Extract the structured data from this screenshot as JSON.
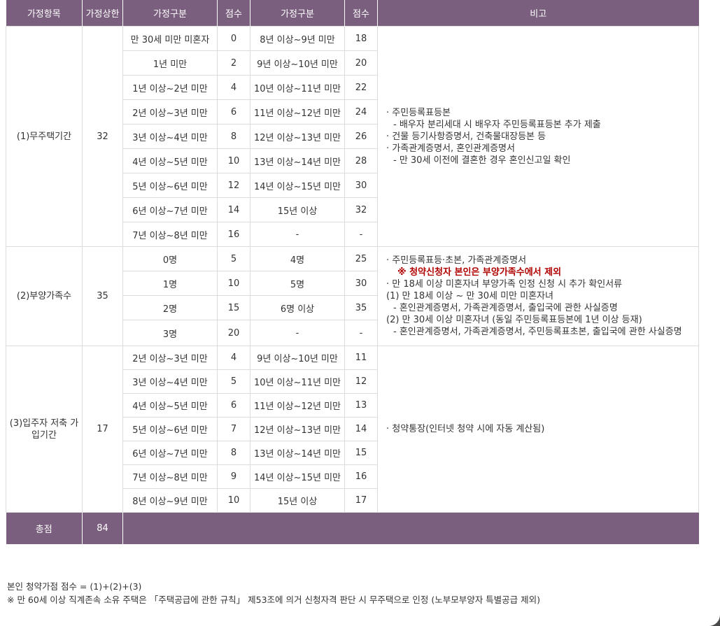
{
  "headers": [
    "가정항목",
    "가정상한",
    "가정구분",
    "점수",
    "가정구분",
    "점수",
    "비고"
  ],
  "sections": [
    {
      "item": "(1)무주택기간",
      "cap": "32",
      "rows": [
        [
          "만 30세 미만 미혼자",
          "0",
          "8년 이상~9년 미만",
          "18"
        ],
        [
          "1년 미만",
          "2",
          "9년 이상~10년 미만",
          "20"
        ],
        [
          "1년 이상~2년 미만",
          "4",
          "10년 이상~11년 미만",
          "22"
        ],
        [
          "2년 이상~3년 미만",
          "6",
          "11년 이상~12년 미만",
          "24"
        ],
        [
          "3년 이상~4년 미만",
          "8",
          "12년 이상~13년 미만",
          "26"
        ],
        [
          "4년 이상~5년 미만",
          "10",
          "13년 이상~14년 미만",
          "28"
        ],
        [
          "5년 이상~6년 미만",
          "12",
          "14년 이상~15년 미만",
          "30"
        ],
        [
          "6년 이상~7년 미만",
          "14",
          "15년 이상",
          "32"
        ],
        [
          "7년 이상~8년 미만",
          "16",
          "-",
          "-"
        ]
      ],
      "notes": [
        {
          "style": "main",
          "text": "· 주민등록표등본"
        },
        {
          "style": "sub",
          "text": "- 배우자 분리세대 시 배우자 주민등록표등본 추가 제출"
        },
        {
          "style": "main",
          "text": "· 건물 등기사항증명서, 건축물대장등본 등"
        },
        {
          "style": "main",
          "text": "· 가족관계증명서, 혼인관계증명서"
        },
        {
          "style": "sub",
          "text": "- 만 30세 이전에 결혼한 경우 혼인신고일 확인"
        }
      ]
    },
    {
      "item": "(2)부양가족수",
      "cap": "35",
      "rows": [
        [
          "0명",
          "5",
          "4명",
          "25"
        ],
        [
          "1명",
          "10",
          "5명",
          "30"
        ],
        [
          "2명",
          "15",
          "6명 이상",
          "35"
        ],
        [
          "3명",
          "20",
          "-",
          "-"
        ]
      ],
      "notes": [
        {
          "style": "main",
          "text": "· 주민등록표등·초본, 가족관계증명서"
        },
        {
          "style": "warn",
          "text": "※ 청약신청자 본인은 부양가족수에서 제외"
        },
        {
          "style": "main",
          "text": "· 만 18세 이상 미혼자녀 부양가족 인정 신청 시 추가 확인서류"
        },
        {
          "style": "main",
          "text": "(1) 만 18세 이상 ~ 만 30세 미만 미혼자녀"
        },
        {
          "style": "sub",
          "text": "- 혼인관계증명서, 가족관계증명서, 출입국에 관한 사실증명"
        },
        {
          "style": "main",
          "text": "(2) 만 30세 이상 미혼자녀 (동일 주민등록표등본에 1년 이상 등재)"
        },
        {
          "style": "sub",
          "text": "- 혼인관계증명서, 가족관계증명서, 주민등록표초본, 출입국에 관한 사실증명"
        }
      ]
    },
    {
      "item": "(3)입주자 저축 가입기간",
      "cap": "17",
      "rows": [
        [
          "2년 이상~3년 미만",
          "4",
          "9년 이상~10년 미만",
          "11"
        ],
        [
          "3년 이상~4년 미만",
          "5",
          "10년 이상~11년 미만",
          "12"
        ],
        [
          "4년 이상~5년 미만",
          "6",
          "11년 이상~12년 미만",
          "13"
        ],
        [
          "5년 이상~6년 미만",
          "7",
          "12년 이상~13년 미만",
          "14"
        ],
        [
          "6년 이상~7년 미만",
          "8",
          "13년 이상~14년 미만",
          "15"
        ],
        [
          "7년 이상~8년 미만",
          "9",
          "14년 이상~15년 미만",
          "16"
        ],
        [
          "8년 이상~9년 미만",
          "10",
          "15년 이상",
          "17"
        ]
      ],
      "notes": [
        {
          "style": "main",
          "text": "· 청약통장(인터넷 청약 시에 자동 계산됨)"
        }
      ]
    }
  ],
  "total": {
    "label": "총점",
    "value": "84"
  },
  "footnotes": [
    "본인 청약가점 점수 = (1)+(2)+(3)",
    "※ 만 60세 이상 직계존속 소유 주택은 「주택공급에 관한 규칙」 제53조에 의거 신청자격 판단 시 무주택으로 인정 (노부모부양자 특별공급 제외)"
  ]
}
